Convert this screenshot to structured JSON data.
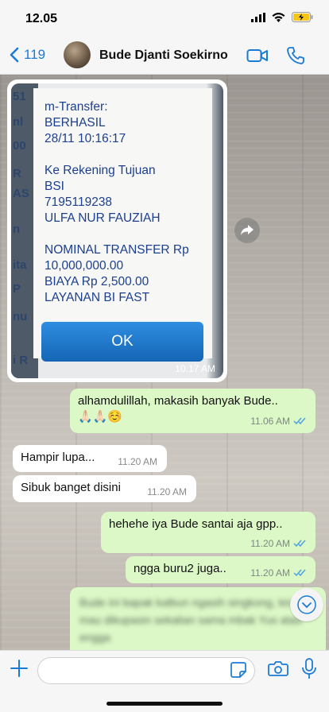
{
  "status": {
    "time": "12.05"
  },
  "header": {
    "back_count": "119",
    "contact_name": "Bude Djanti Soekirno"
  },
  "image_message": {
    "receipt_lines": [
      "m-Transfer:",
      "BERHASIL",
      "28/11 10:16:17",
      "",
      "Ke Rekening Tujuan",
      "BSI",
      "7195119238",
      "ULFA NUR FAUZIAH",
      "",
      "NOMINAL TRANSFER Rp",
      "10,000,000.00",
      "BIAYA Rp 2,500.00",
      "LAYANAN BI FAST"
    ],
    "ok_label": "OK",
    "time": "10.17 AM"
  },
  "messages": [
    {
      "dir": "out",
      "text": "alhamdulillah, makasih banyak Bude..",
      "emoji": "🙏🏻🙏🏻☺️",
      "time": "11.06 AM"
    },
    {
      "dir": "in",
      "text": "Hampir lupa...",
      "time": "11.20 AM"
    },
    {
      "dir": "in",
      "text": "Sibuk banget disini",
      "time": "11.20 AM"
    },
    {
      "dir": "out",
      "text": "hehehe iya Bude santai aja gpp..",
      "time": "11.20 AM"
    },
    {
      "dir": "out",
      "text": "ngga buru2 juga..",
      "time": "11.20 AM"
    }
  ],
  "blurred_message": {
    "text": "Bude ini bapak kalbun ngasih singkong, kira2 mau dikupasin sekalian sama mbak Yus atau engga"
  },
  "colors": {
    "accent": "#1a7bd6",
    "outgoing": "#dcf8c6",
    "incoming": "#ffffff",
    "read_ticks": "#4fa3e0"
  }
}
